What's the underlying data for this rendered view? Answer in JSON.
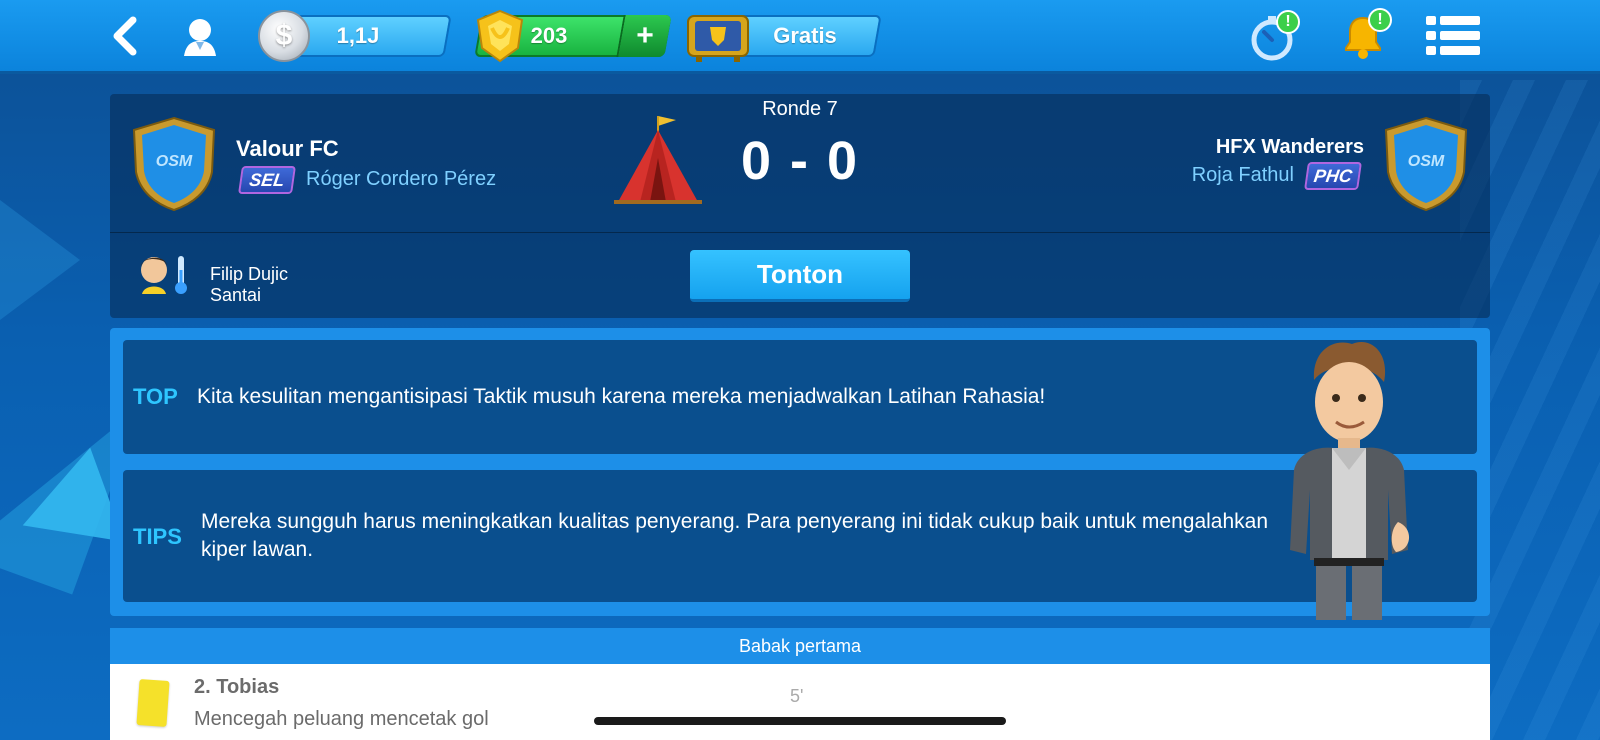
{
  "topbar": {
    "money": "1,1J",
    "money_symbol": "$",
    "gems": "203",
    "gems_plus": "+",
    "tv_label": "Gratis",
    "timer_alert": "!",
    "bell_alert": "!"
  },
  "match": {
    "round": "Ronde 7",
    "home_team": "Valour FC",
    "home_manager": "Róger Cordero Pérez",
    "home_badge": "SEL",
    "home_crest": "OSM",
    "away_team": "HFX Wanderers",
    "away_manager": "Roja Fathul",
    "away_badge": "PHC",
    "away_crest": "OSM",
    "score": "0 - 0",
    "coach_name": "Filip Dujic",
    "coach_status": "Santai",
    "watch_label": "Tonton"
  },
  "tips": [
    {
      "key": "TOP",
      "text": "Kita kesulitan mengantisipasi Taktik musuh karena mereka menjadwalkan Latihan Rahasia!"
    },
    {
      "key": "TIPS",
      "text": "Mereka sungguh harus meningkatkan kualitas penyerang. Para penyerang ini tidak cukup baik untuk mengalahkan kiper lawan."
    }
  ],
  "timeline": {
    "half_label": "Babak pertama",
    "event_player": "2. Tobias",
    "event_desc": "Mencegah peluang mencetak gol",
    "event_minute": "5'"
  },
  "colors": {
    "topbar": "#0b83dc",
    "accent": "#2ec6ff",
    "gems": "#19b340",
    "card_yellow": "#f5e12a"
  },
  "icons": [
    "back-icon",
    "profile-icon",
    "coin-icon",
    "gem-icon",
    "tv-icon",
    "timer-icon",
    "bell-icon",
    "menu-icon",
    "tent-icon",
    "crest-icon",
    "thermometer-icon",
    "yellow-card-icon"
  ]
}
